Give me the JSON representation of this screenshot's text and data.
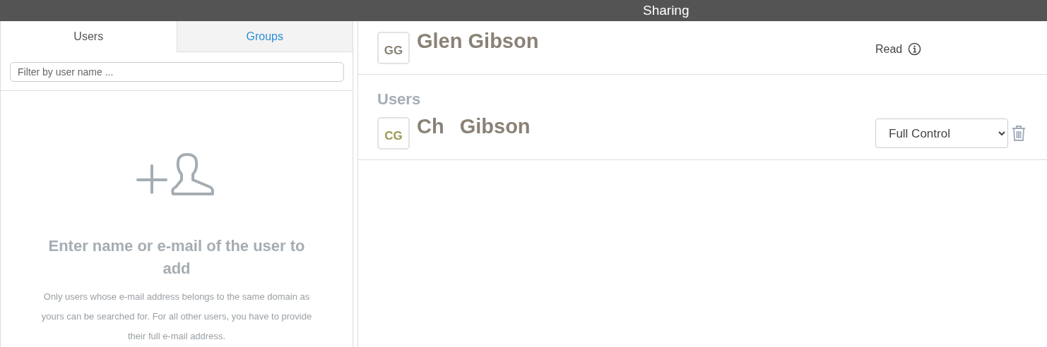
{
  "window": {
    "title": "Sharing"
  },
  "tabs": [
    {
      "label": "Users",
      "selected": true
    },
    {
      "label": "Groups",
      "selected": false
    }
  ],
  "filter": {
    "placeholder": "Filter by user name ..."
  },
  "empty_state": {
    "heading": "Enter name or e-mail of the user to add",
    "text": "Only users whose e-mail address belongs to the same domain as yours can be searched for. For all other users, you have to provide their full e-mail address."
  },
  "owner": {
    "initials": "GG",
    "name_parts": [
      "Glen Gibson"
    ],
    "permission": "Read",
    "color": "#8a8276"
  },
  "users_heading": "Users",
  "users": [
    {
      "initials": "CG",
      "name_parts": [
        "Ch",
        "Gibson"
      ],
      "permission": "Full Control",
      "color": "#9a9a52"
    }
  ]
}
